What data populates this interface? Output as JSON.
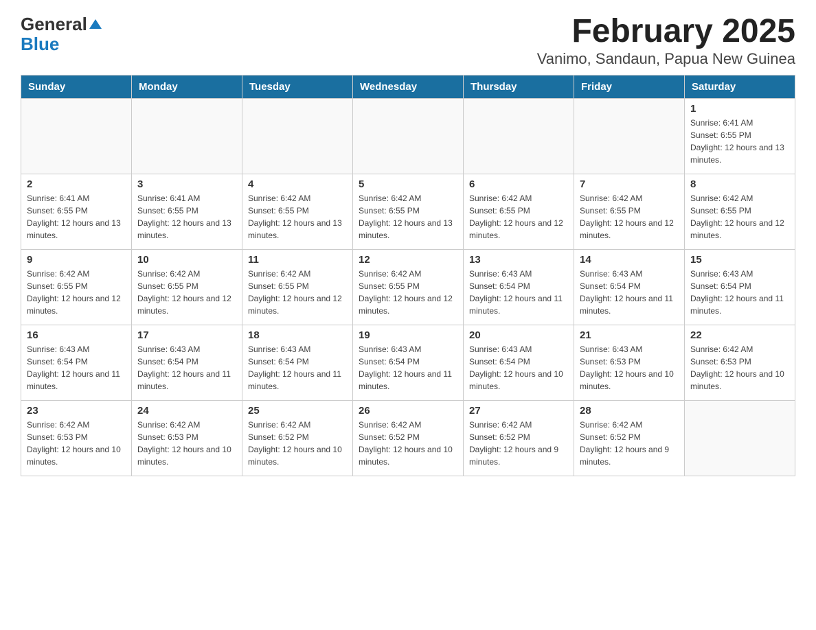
{
  "header": {
    "logo_general": "General",
    "logo_blue": "Blue",
    "title": "February 2025",
    "subtitle": "Vanimo, Sandaun, Papua New Guinea"
  },
  "days_of_week": [
    "Sunday",
    "Monday",
    "Tuesday",
    "Wednesday",
    "Thursday",
    "Friday",
    "Saturday"
  ],
  "weeks": [
    [
      {
        "day": "",
        "info": ""
      },
      {
        "day": "",
        "info": ""
      },
      {
        "day": "",
        "info": ""
      },
      {
        "day": "",
        "info": ""
      },
      {
        "day": "",
        "info": ""
      },
      {
        "day": "",
        "info": ""
      },
      {
        "day": "1",
        "info": "Sunrise: 6:41 AM\nSunset: 6:55 PM\nDaylight: 12 hours and 13 minutes."
      }
    ],
    [
      {
        "day": "2",
        "info": "Sunrise: 6:41 AM\nSunset: 6:55 PM\nDaylight: 12 hours and 13 minutes."
      },
      {
        "day": "3",
        "info": "Sunrise: 6:41 AM\nSunset: 6:55 PM\nDaylight: 12 hours and 13 minutes."
      },
      {
        "day": "4",
        "info": "Sunrise: 6:42 AM\nSunset: 6:55 PM\nDaylight: 12 hours and 13 minutes."
      },
      {
        "day": "5",
        "info": "Sunrise: 6:42 AM\nSunset: 6:55 PM\nDaylight: 12 hours and 13 minutes."
      },
      {
        "day": "6",
        "info": "Sunrise: 6:42 AM\nSunset: 6:55 PM\nDaylight: 12 hours and 12 minutes."
      },
      {
        "day": "7",
        "info": "Sunrise: 6:42 AM\nSunset: 6:55 PM\nDaylight: 12 hours and 12 minutes."
      },
      {
        "day": "8",
        "info": "Sunrise: 6:42 AM\nSunset: 6:55 PM\nDaylight: 12 hours and 12 minutes."
      }
    ],
    [
      {
        "day": "9",
        "info": "Sunrise: 6:42 AM\nSunset: 6:55 PM\nDaylight: 12 hours and 12 minutes."
      },
      {
        "day": "10",
        "info": "Sunrise: 6:42 AM\nSunset: 6:55 PM\nDaylight: 12 hours and 12 minutes."
      },
      {
        "day": "11",
        "info": "Sunrise: 6:42 AM\nSunset: 6:55 PM\nDaylight: 12 hours and 12 minutes."
      },
      {
        "day": "12",
        "info": "Sunrise: 6:42 AM\nSunset: 6:55 PM\nDaylight: 12 hours and 12 minutes."
      },
      {
        "day": "13",
        "info": "Sunrise: 6:43 AM\nSunset: 6:54 PM\nDaylight: 12 hours and 11 minutes."
      },
      {
        "day": "14",
        "info": "Sunrise: 6:43 AM\nSunset: 6:54 PM\nDaylight: 12 hours and 11 minutes."
      },
      {
        "day": "15",
        "info": "Sunrise: 6:43 AM\nSunset: 6:54 PM\nDaylight: 12 hours and 11 minutes."
      }
    ],
    [
      {
        "day": "16",
        "info": "Sunrise: 6:43 AM\nSunset: 6:54 PM\nDaylight: 12 hours and 11 minutes."
      },
      {
        "day": "17",
        "info": "Sunrise: 6:43 AM\nSunset: 6:54 PM\nDaylight: 12 hours and 11 minutes."
      },
      {
        "day": "18",
        "info": "Sunrise: 6:43 AM\nSunset: 6:54 PM\nDaylight: 12 hours and 11 minutes."
      },
      {
        "day": "19",
        "info": "Sunrise: 6:43 AM\nSunset: 6:54 PM\nDaylight: 12 hours and 11 minutes."
      },
      {
        "day": "20",
        "info": "Sunrise: 6:43 AM\nSunset: 6:54 PM\nDaylight: 12 hours and 10 minutes."
      },
      {
        "day": "21",
        "info": "Sunrise: 6:43 AM\nSunset: 6:53 PM\nDaylight: 12 hours and 10 minutes."
      },
      {
        "day": "22",
        "info": "Sunrise: 6:42 AM\nSunset: 6:53 PM\nDaylight: 12 hours and 10 minutes."
      }
    ],
    [
      {
        "day": "23",
        "info": "Sunrise: 6:42 AM\nSunset: 6:53 PM\nDaylight: 12 hours and 10 minutes."
      },
      {
        "day": "24",
        "info": "Sunrise: 6:42 AM\nSunset: 6:53 PM\nDaylight: 12 hours and 10 minutes."
      },
      {
        "day": "25",
        "info": "Sunrise: 6:42 AM\nSunset: 6:52 PM\nDaylight: 12 hours and 10 minutes."
      },
      {
        "day": "26",
        "info": "Sunrise: 6:42 AM\nSunset: 6:52 PM\nDaylight: 12 hours and 10 minutes."
      },
      {
        "day": "27",
        "info": "Sunrise: 6:42 AM\nSunset: 6:52 PM\nDaylight: 12 hours and 9 minutes."
      },
      {
        "day": "28",
        "info": "Sunrise: 6:42 AM\nSunset: 6:52 PM\nDaylight: 12 hours and 9 minutes."
      },
      {
        "day": "",
        "info": ""
      }
    ]
  ]
}
